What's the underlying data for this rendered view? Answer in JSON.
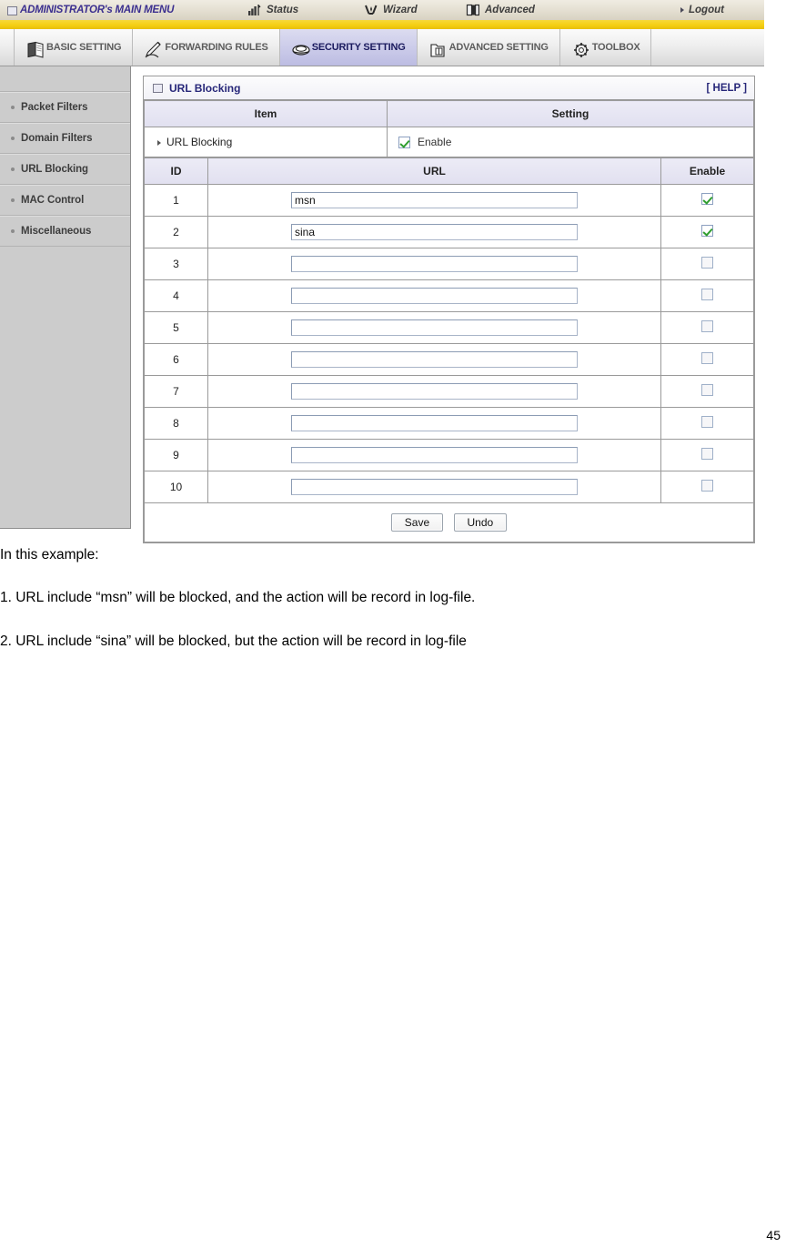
{
  "topbar": {
    "admin_menu": "ADMINISTRATOR's MAIN MENU",
    "status": "Status",
    "wizard": "Wizard",
    "advanced": "Advanced",
    "logout": "Logout"
  },
  "tabs": [
    {
      "label": "BASIC SETTING",
      "icon": "book-icon",
      "active": false
    },
    {
      "label": "FORWARDING RULES",
      "icon": "pen-icon",
      "active": false
    },
    {
      "label": "SECURITY SETTING",
      "icon": "shield-icon",
      "active": true
    },
    {
      "label": "ADVANCED SETTING",
      "icon": "folder-icon",
      "active": false
    },
    {
      "label": "TOOLBOX",
      "icon": "gear-icon",
      "active": false
    }
  ],
  "sidebar": {
    "items": [
      {
        "label": "Packet Filters"
      },
      {
        "label": "Domain Filters"
      },
      {
        "label": "URL Blocking"
      },
      {
        "label": "MAC Control"
      },
      {
        "label": "Miscellaneous"
      }
    ]
  },
  "panel": {
    "title": "URL Blocking",
    "help": "[ HELP ]",
    "col_item": "Item",
    "col_setting": "Setting",
    "url_blocking_label": "URL Blocking",
    "enable_label": "Enable",
    "url_blocking_enabled": true
  },
  "table": {
    "headers": [
      "ID",
      "URL",
      "Enable"
    ],
    "rows": [
      {
        "id": "1",
        "url": "msn",
        "enabled": true
      },
      {
        "id": "2",
        "url": "sina",
        "enabled": true
      },
      {
        "id": "3",
        "url": "",
        "enabled": false
      },
      {
        "id": "4",
        "url": "",
        "enabled": false
      },
      {
        "id": "5",
        "url": "",
        "enabled": false
      },
      {
        "id": "6",
        "url": "",
        "enabled": false
      },
      {
        "id": "7",
        "url": "",
        "enabled": false
      },
      {
        "id": "8",
        "url": "",
        "enabled": false
      },
      {
        "id": "9",
        "url": "",
        "enabled": false
      },
      {
        "id": "10",
        "url": "",
        "enabled": false
      }
    ]
  },
  "buttons": {
    "save": "Save",
    "undo": "Undo"
  },
  "document": {
    "intro": "In this example:",
    "item1": "1. URL include “msn” will be blocked, and the action will be record in log-file.",
    "item2": "2. URL include “sina” will be blocked, but the action will be record in log-file",
    "page_number": "45"
  },
  "colors": {
    "accent_purple": "#272779",
    "tab_active_bg": "#bcbce2",
    "strip_yellow": "#f5cf14",
    "sidebar_gray": "#cccccc",
    "check_green": "#2f9e2f"
  }
}
